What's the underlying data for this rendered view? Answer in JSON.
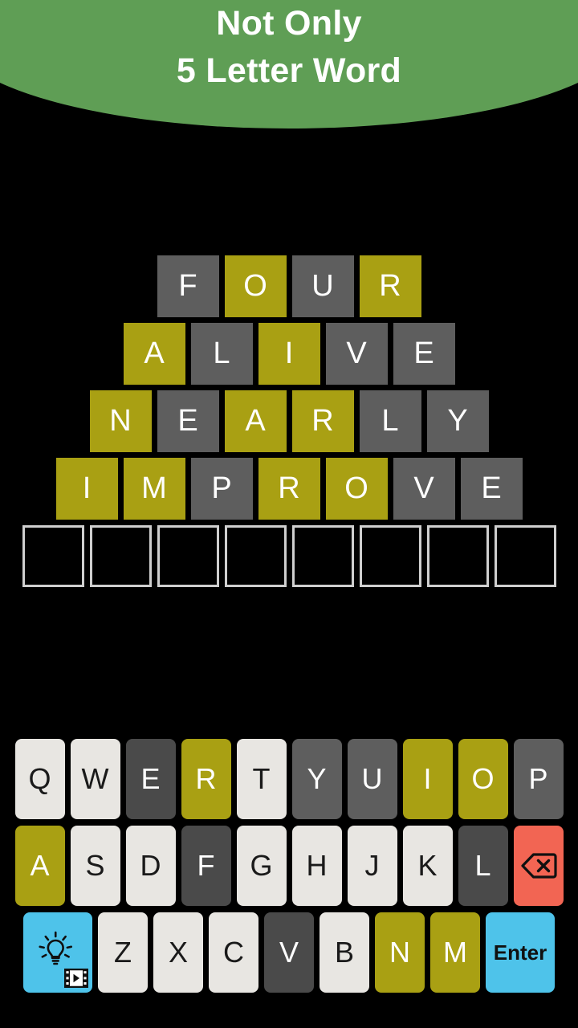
{
  "header": {
    "title": "Not Only\n5 Letter Word",
    "background_color": "#5f9e55",
    "text_color": "#ffffff"
  },
  "colors": {
    "background": "#000000",
    "present": "#a9a013",
    "absent": "#5e5e5e",
    "absent_dark": "#4a4a4a",
    "key_unused": "#e8e6e2",
    "action_blue": "#4ec3ea",
    "action_red": "#f26553",
    "empty_tile_border": "#cfcfcf"
  },
  "board": {
    "rows": [
      {
        "word": "FOUR",
        "length": 4,
        "tiles": [
          {
            "letter": "F",
            "state": "absent"
          },
          {
            "letter": "O",
            "state": "present"
          },
          {
            "letter": "U",
            "state": "absent"
          },
          {
            "letter": "R",
            "state": "present"
          }
        ]
      },
      {
        "word": "ALIVE",
        "length": 5,
        "tiles": [
          {
            "letter": "A",
            "state": "present"
          },
          {
            "letter": "L",
            "state": "absent"
          },
          {
            "letter": "I",
            "state": "present"
          },
          {
            "letter": "V",
            "state": "absent"
          },
          {
            "letter": "E",
            "state": "absent"
          }
        ]
      },
      {
        "word": "NEARLY",
        "length": 6,
        "tiles": [
          {
            "letter": "N",
            "state": "present"
          },
          {
            "letter": "E",
            "state": "absent"
          },
          {
            "letter": "A",
            "state": "present"
          },
          {
            "letter": "R",
            "state": "present"
          },
          {
            "letter": "L",
            "state": "absent"
          },
          {
            "letter": "Y",
            "state": "absent"
          }
        ]
      },
      {
        "word": "IMPROVE",
        "length": 7,
        "tiles": [
          {
            "letter": "I",
            "state": "present"
          },
          {
            "letter": "M",
            "state": "present"
          },
          {
            "letter": "P",
            "state": "absent"
          },
          {
            "letter": "R",
            "state": "present"
          },
          {
            "letter": "O",
            "state": "present"
          },
          {
            "letter": "V",
            "state": "absent"
          },
          {
            "letter": "E",
            "state": "absent"
          }
        ]
      },
      {
        "word": "",
        "length": 8,
        "tiles": [
          {
            "letter": "",
            "state": "empty"
          },
          {
            "letter": "",
            "state": "empty"
          },
          {
            "letter": "",
            "state": "empty"
          },
          {
            "letter": "",
            "state": "empty"
          },
          {
            "letter": "",
            "state": "empty"
          },
          {
            "letter": "",
            "state": "empty"
          },
          {
            "letter": "",
            "state": "empty"
          },
          {
            "letter": "",
            "state": "empty"
          }
        ]
      }
    ]
  },
  "keyboard": {
    "rows": [
      [
        {
          "label": "Q",
          "state": "unused"
        },
        {
          "label": "W",
          "state": "unused"
        },
        {
          "label": "E",
          "state": "absent-dark"
        },
        {
          "label": "R",
          "state": "present"
        },
        {
          "label": "T",
          "state": "unused"
        },
        {
          "label": "Y",
          "state": "absent"
        },
        {
          "label": "U",
          "state": "absent"
        },
        {
          "label": "I",
          "state": "present"
        },
        {
          "label": "O",
          "state": "present"
        },
        {
          "label": "P",
          "state": "absent"
        }
      ],
      [
        {
          "label": "A",
          "state": "present"
        },
        {
          "label": "S",
          "state": "unused"
        },
        {
          "label": "D",
          "state": "unused"
        },
        {
          "label": "F",
          "state": "absent-dark"
        },
        {
          "label": "G",
          "state": "unused"
        },
        {
          "label": "H",
          "state": "unused"
        },
        {
          "label": "J",
          "state": "unused"
        },
        {
          "label": "K",
          "state": "unused"
        },
        {
          "label": "L",
          "state": "absent-dark"
        },
        {
          "label": "",
          "state": "action-red",
          "icon": "backspace-icon",
          "name": "backspace-key"
        }
      ],
      [
        {
          "label": "",
          "state": "action-blue",
          "icon": "hint-lightbulb-video-icon",
          "name": "hint-key",
          "wide": true
        },
        {
          "label": "Z",
          "state": "unused"
        },
        {
          "label": "X",
          "state": "unused"
        },
        {
          "label": "C",
          "state": "unused"
        },
        {
          "label": "V",
          "state": "absent-dark"
        },
        {
          "label": "B",
          "state": "unused"
        },
        {
          "label": "N",
          "state": "present"
        },
        {
          "label": "M",
          "state": "present"
        },
        {
          "label": "Enter",
          "state": "action-blue",
          "name": "enter-key",
          "wide": true
        }
      ]
    ]
  }
}
